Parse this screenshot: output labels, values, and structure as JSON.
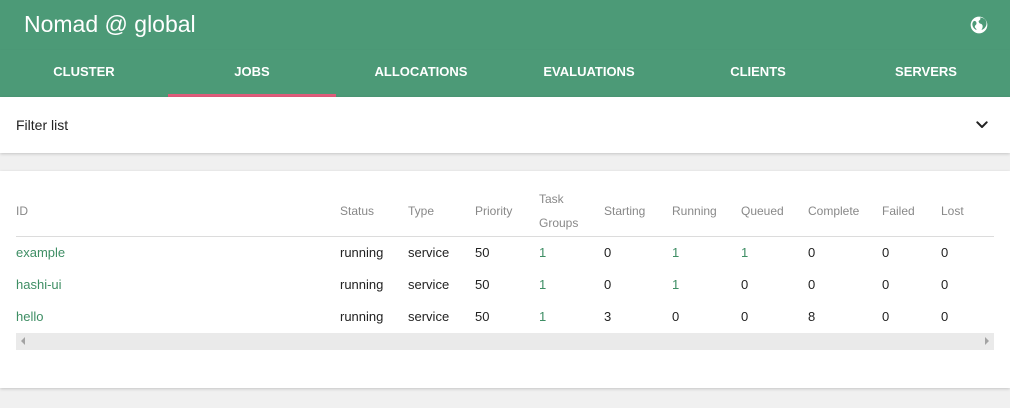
{
  "app": {
    "title": "Nomad @ global",
    "region_icon": "globe-icon"
  },
  "tabs": [
    {
      "label": "CLUSTER",
      "active": false
    },
    {
      "label": "JOBS",
      "active": true
    },
    {
      "label": "ALLOCATIONS",
      "active": false
    },
    {
      "label": "EVALUATIONS",
      "active": false
    },
    {
      "label": "CLIENTS",
      "active": false
    },
    {
      "label": "SERVERS",
      "active": false
    }
  ],
  "filter": {
    "label": "Filter list",
    "toggle_icon": "chevron-down-icon"
  },
  "jobs_table": {
    "columns": {
      "id": "ID",
      "status": "Status",
      "type": "Type",
      "priority": "Priority",
      "task_groups_line1": "Task",
      "task_groups_line2": "Groups",
      "starting": "Starting",
      "running": "Running",
      "queued": "Queued",
      "complete": "Complete",
      "failed": "Failed",
      "lost": "Lost"
    },
    "rows": [
      {
        "id": "example",
        "status": "running",
        "type": "service",
        "priority": "50",
        "task_groups": "1",
        "starting": "0",
        "running": "1",
        "queued": "1",
        "complete": "0",
        "failed": "0",
        "lost": "0"
      },
      {
        "id": "hashi-ui",
        "status": "running",
        "type": "service",
        "priority": "50",
        "task_groups": "1",
        "starting": "0",
        "running": "1",
        "queued": "0",
        "complete": "0",
        "failed": "0",
        "lost": "0"
      },
      {
        "id": "hello",
        "status": "running",
        "type": "service",
        "priority": "50",
        "task_groups": "1",
        "starting": "3",
        "running": "0",
        "queued": "0",
        "complete": "8",
        "failed": "0",
        "lost": "0"
      }
    ]
  },
  "colors": {
    "primary": "#4c9a77",
    "active_tab_indicator": "#e05c7b",
    "link": "#3e8e64"
  }
}
